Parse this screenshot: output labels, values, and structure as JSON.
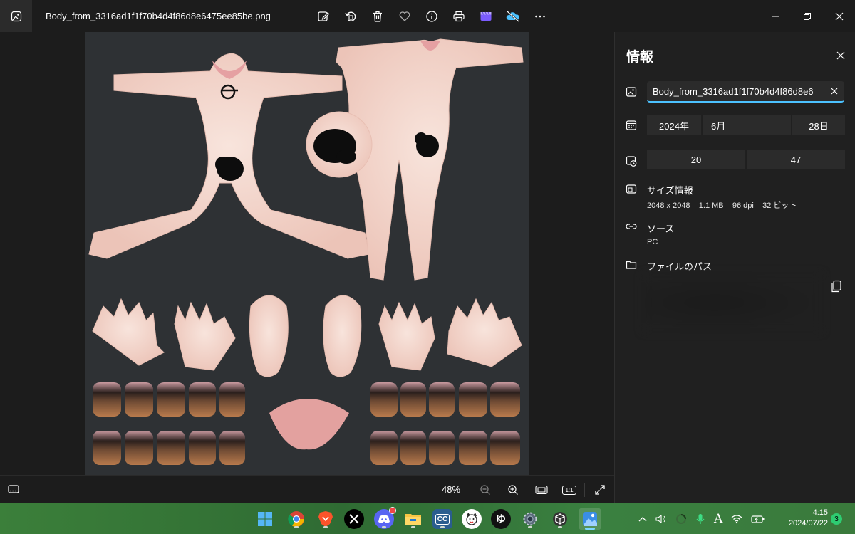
{
  "window": {
    "file_name": "Body_from_3316ad1f1f70b4d4f86d8e6475ee85be.png",
    "toolbar_icons": [
      "edit-icon",
      "rotate-icon",
      "delete-icon",
      "favorite-icon",
      "info-icon",
      "print-icon",
      "clipchamp-icon",
      "onedrive-icon",
      "more-icon"
    ]
  },
  "viewer": {
    "zoom": "48%",
    "actual_size_label": "1:1"
  },
  "info_panel": {
    "title": "情報",
    "file_name_value": "Body_from_3316ad1f1f70b4d4f86d8e6",
    "date": {
      "year": "2024年",
      "month": "6月",
      "day": "28日"
    },
    "time": {
      "hour": "20",
      "minute": "47"
    },
    "size_info": {
      "label": "サイズ情報",
      "dimensions": "2048 x 2048",
      "file_size": "1.1 MB",
      "dpi": "96 dpi",
      "bit_depth": "32 ビット"
    },
    "source": {
      "label": "ソース",
      "value": "PC"
    },
    "file_path": {
      "label": "ファイルのパス"
    }
  },
  "taskbar": {
    "apps": [
      "windows-start",
      "chrome",
      "brave",
      "x",
      "discord",
      "file-explorer",
      "cc",
      "app-dog",
      "yu",
      "settings",
      "unity",
      "photos"
    ],
    "clock_time": "4:15",
    "clock_date": "2024/07/22",
    "notification_count": "3",
    "ime_indicator": "A"
  },
  "colors": {
    "accent": "#4cc2ff",
    "canvas_bg": "#2e3134",
    "skin": "#f4d8cf",
    "taskbar_green": "#3b7f3a"
  }
}
